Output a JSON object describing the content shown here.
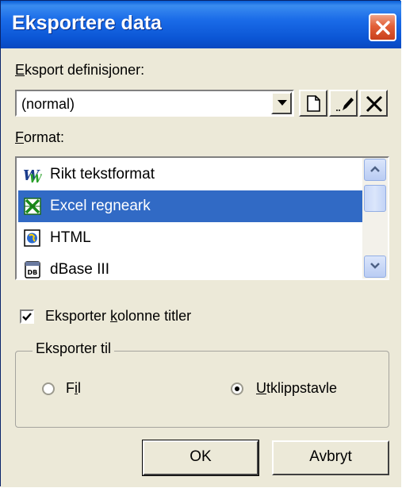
{
  "window": {
    "title": "Eksportere data"
  },
  "definitions": {
    "label_prefix": "",
    "label_hotkey": "E",
    "label_rest": "ksport definisjoner:",
    "value": "(normal)"
  },
  "format": {
    "label_hotkey": "F",
    "label_rest": "ormat:",
    "items": [
      {
        "label": "Rikt tekstformat",
        "icon": "wordpad-icon",
        "selected": false
      },
      {
        "label": "Excel regneark",
        "icon": "excel-icon",
        "selected": true
      },
      {
        "label": "HTML",
        "icon": "html-icon",
        "selected": false
      },
      {
        "label": "dBase III",
        "icon": "dbase-icon",
        "selected": false
      }
    ]
  },
  "export_titles": {
    "label_a": "Eksporter ",
    "label_hotkey": "k",
    "label_b": "olonne titler",
    "checked": true
  },
  "export_to": {
    "legend": "Eksporter til",
    "file_a": "F",
    "file_hotkey": "i",
    "file_b": "l",
    "clipboard_hotkey": "U",
    "clipboard_rest": "tklippstavle",
    "selected": "clipboard"
  },
  "buttons": {
    "ok": "OK",
    "cancel": "Avbryt"
  },
  "colors": {
    "title_bar": "#0a5fd8",
    "selection": "#316ac5",
    "dialog_bg": "#ece9d8",
    "close": "#e26038"
  }
}
